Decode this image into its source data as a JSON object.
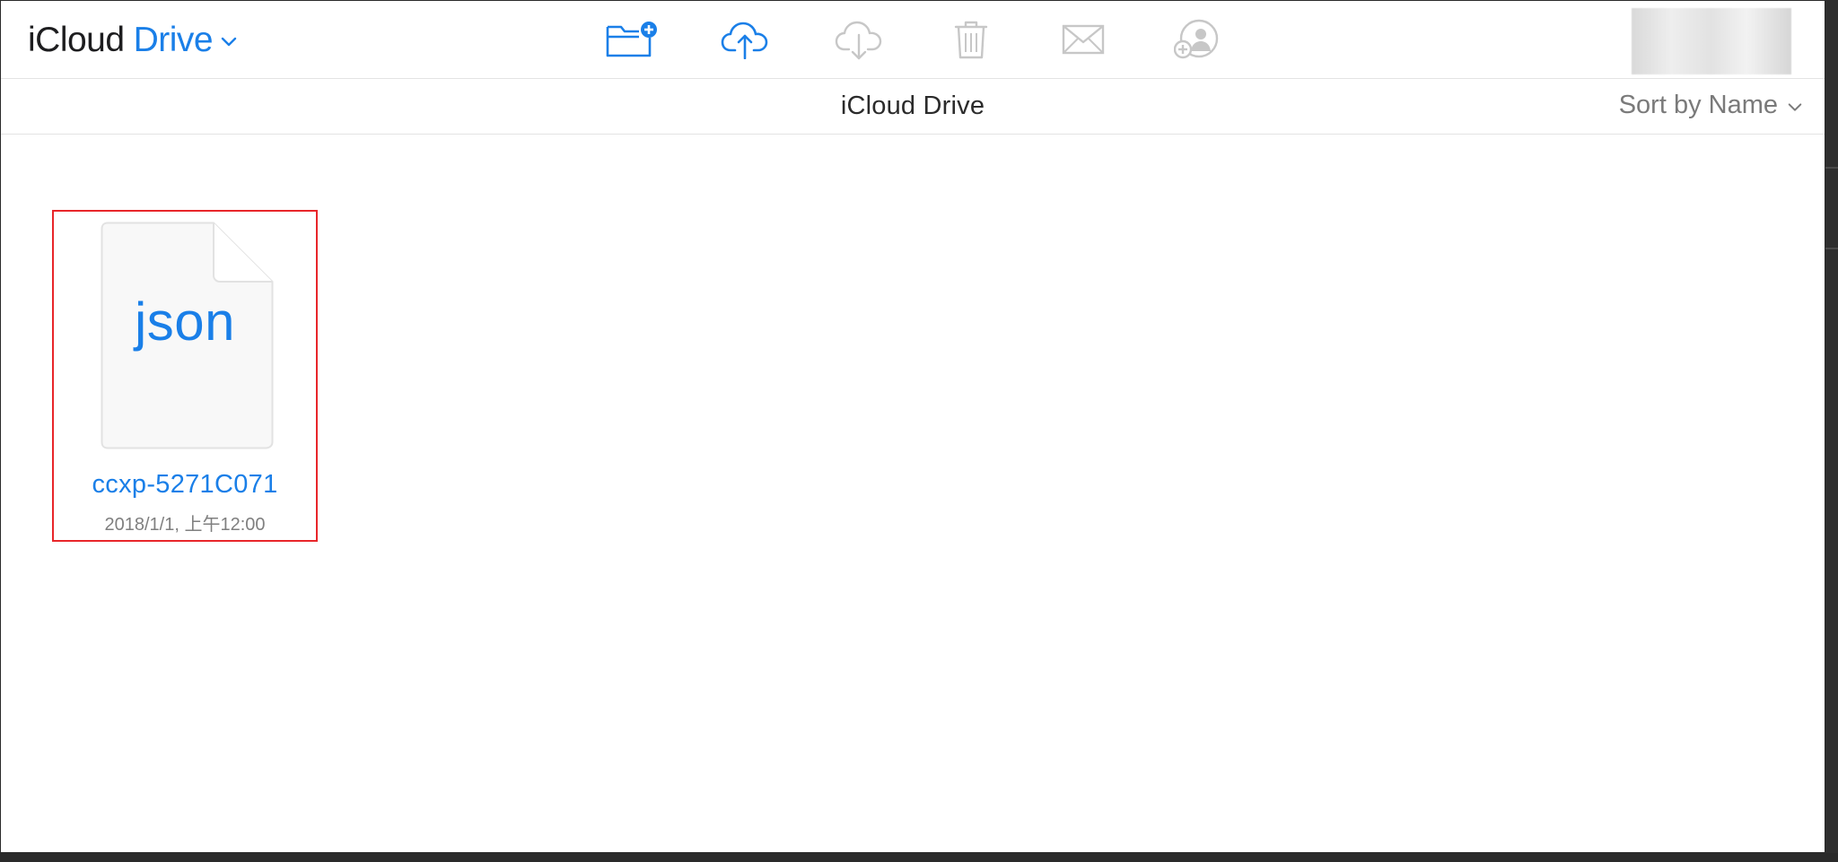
{
  "app": {
    "title_part1": "iCloud",
    "title_part2": "Drive"
  },
  "toolbar": {
    "buttons": [
      {
        "name": "new-folder",
        "icon": "folder-plus-icon",
        "enabled": true
      },
      {
        "name": "upload",
        "icon": "cloud-upload-icon",
        "enabled": true
      },
      {
        "name": "download",
        "icon": "cloud-download-icon",
        "enabled": false
      },
      {
        "name": "delete",
        "icon": "trash-icon",
        "enabled": false
      },
      {
        "name": "email",
        "icon": "envelope-icon",
        "enabled": false
      },
      {
        "name": "share",
        "icon": "add-person-icon",
        "enabled": false
      }
    ]
  },
  "header": {
    "folder_title": "iCloud Drive",
    "sort_label": "Sort by Name"
  },
  "files": [
    {
      "extension": "json",
      "name": "ccxp-5271C071",
      "date": "2018/1/1, 上午12:00",
      "selected": true
    }
  ],
  "colors": {
    "accent": "#1a7fe8",
    "disabled": "#c7c7c7",
    "selection_border": "#e8262a"
  }
}
